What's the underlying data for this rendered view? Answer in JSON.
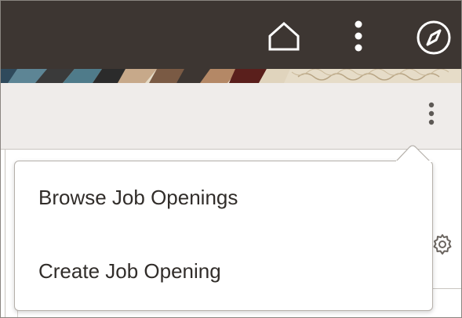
{
  "header": {
    "icons": [
      "home-icon",
      "actions-kebab-icon",
      "navigator-compass-icon"
    ],
    "background_color": "#3d3632",
    "icon_color": "#ffffff"
  },
  "toolbar": {
    "icons": [
      "more-actions-kebab-icon"
    ],
    "background_color": "#efecea"
  },
  "content": {
    "icons": [
      "settings-gear-icon"
    ]
  },
  "popup_menu": {
    "items": [
      {
        "label": "Browse Job Openings"
      },
      {
        "label": "Create Job Opening"
      }
    ]
  }
}
